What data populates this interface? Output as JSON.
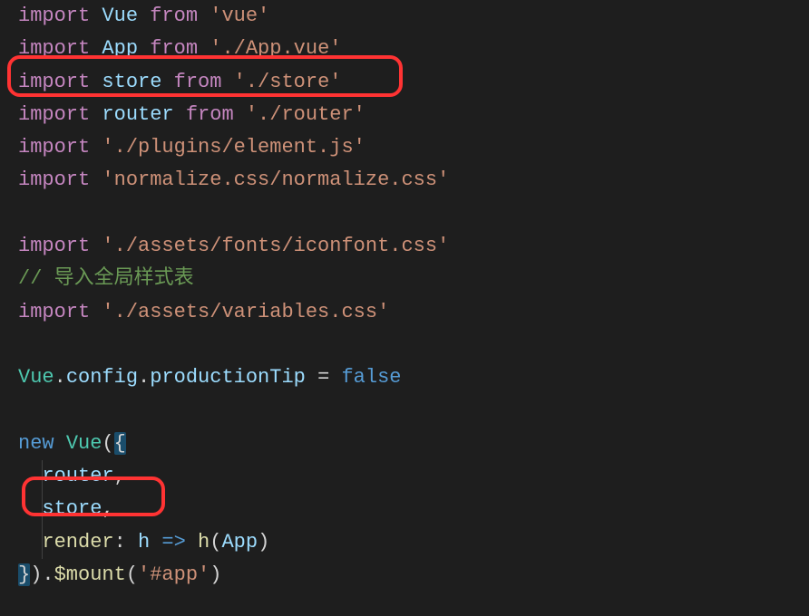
{
  "code": {
    "line1": {
      "import": "import",
      "name": "Vue",
      "from": "from",
      "path": "'vue'"
    },
    "line2": {
      "import": "import",
      "name": "App",
      "from": "from",
      "path": "'./App.vue'"
    },
    "line3": {
      "import": "import",
      "name": "store",
      "from": "from",
      "path": "'./store'"
    },
    "line4": {
      "import": "import",
      "name": "router",
      "from": "from",
      "path": "'./router'"
    },
    "line5": {
      "import": "import",
      "path": "'./plugins/element.js'"
    },
    "line6": {
      "import": "import",
      "path": "'normalize.css/normalize.css'"
    },
    "line7": {
      "import": "import",
      "path": "'./assets/fonts/iconfont.css'"
    },
    "comment": "// 导入全局样式表",
    "line8": {
      "import": "import",
      "path": "'./assets/variables.css'"
    },
    "config": {
      "vue": "Vue",
      "dot1": ".",
      "config_word": "config",
      "dot2": ".",
      "prop": "productionTip",
      "equals": " = ",
      "value": "false"
    },
    "vue_instance": {
      "new_kw": "new",
      "vue_class": "Vue",
      "open": "({",
      "router_prop": "router",
      "comma1": ",",
      "store_prop": "store",
      "comma2": ",",
      "render_prop": "render",
      "colon": ": ",
      "h_param": "h",
      "arrow": " => ",
      "h_call": "h",
      "app_arg": "App",
      "close_inner": ")",
      "close_outer": "}).",
      "mount_fn": "$mount",
      "mount_arg": "'#app'",
      "mount_close": ")"
    }
  }
}
